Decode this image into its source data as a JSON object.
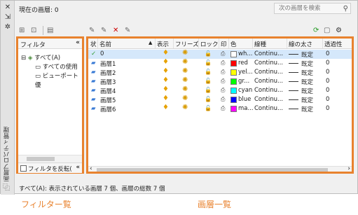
{
  "status": {
    "current_layer": "現在の画層: 0",
    "summary": "すべて(A): 表示されている画層 7 個、画層の総数 7 個"
  },
  "search": {
    "placeholder": "次の画層を検索",
    "icon": "search-icon"
  },
  "side": {
    "title": "画層プロパティ管理",
    "close": "✕",
    "pin": "⇲",
    "settings": "✲",
    "bottom_icon": "⿻"
  },
  "filters": {
    "header": "フィルタ",
    "collapse": "«",
    "tree": [
      {
        "label": "すべて(A)",
        "bold": true
      },
      {
        "label": "すべての使用"
      },
      {
        "label": "ビューポート優"
      }
    ],
    "invert_label": "フィルタを反転("
  },
  "layers": {
    "headers": [
      "状",
      "名前",
      "表示",
      "フリーズ",
      "ロック",
      "印",
      "色",
      "線種",
      "線の太さ",
      "透過性"
    ],
    "rows": [
      {
        "status": "✓",
        "name": "0",
        "color_name": "wh...",
        "color_hex": "#ffffff",
        "linetype": "Continu...",
        "lineweight": "既定",
        "transparency": "0"
      },
      {
        "status": "▰",
        "name": "画層1",
        "color_name": "red",
        "color_hex": "#ff0000",
        "linetype": "Continu...",
        "lineweight": "既定",
        "transparency": "0"
      },
      {
        "status": "▰",
        "name": "画層2",
        "color_name": "yel...",
        "color_hex": "#ffff00",
        "linetype": "Continu...",
        "lineweight": "既定",
        "transparency": "0"
      },
      {
        "status": "▰",
        "name": "画層3",
        "color_name": "gr...",
        "color_hex": "#00ff00",
        "linetype": "Continu...",
        "lineweight": "既定",
        "transparency": "0"
      },
      {
        "status": "▰",
        "name": "画層4",
        "color_name": "cyan",
        "color_hex": "#00ffff",
        "linetype": "Continu...",
        "lineweight": "既定",
        "transparency": "0"
      },
      {
        "status": "▰",
        "name": "画層5",
        "color_name": "blue",
        "color_hex": "#0000ff",
        "linetype": "Continu...",
        "lineweight": "既定",
        "transparency": "0"
      },
      {
        "status": "▰",
        "name": "画層6",
        "color_name": "ma...",
        "color_hex": "#ff00ff",
        "linetype": "Continu...",
        "lineweight": "既定",
        "transparency": "0"
      }
    ]
  },
  "captions": {
    "filter_list": "フィルター覧",
    "layer_list": "画層一覧"
  },
  "accent": "#e8822e"
}
